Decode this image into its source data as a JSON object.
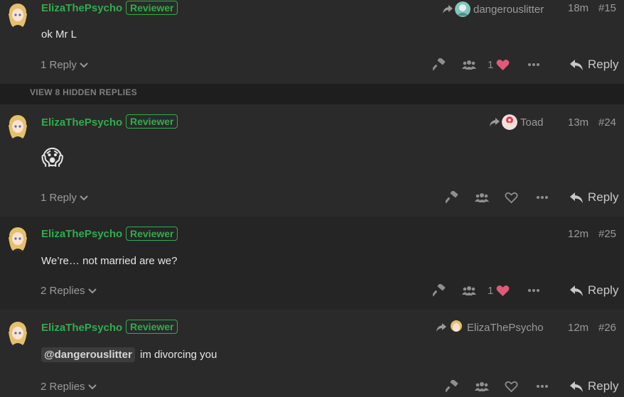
{
  "posts": [
    {
      "username": "ElizaThePsycho",
      "badge": "Reviewer",
      "reply_to": "dangerouslitter",
      "time": "18m",
      "number": "#15",
      "content": "ok Mr L",
      "replies": "1 Reply",
      "likes": "1",
      "liked": true,
      "reply_label": "Reply"
    },
    {
      "username": "ElizaThePsycho",
      "badge": "Reviewer",
      "reply_to": "Toad",
      "time": "13m",
      "number": "#24",
      "content_emoji": "😱",
      "replies": "1 Reply",
      "likes": "",
      "liked": false,
      "reply_label": "Reply"
    },
    {
      "username": "ElizaThePsycho",
      "badge": "Reviewer",
      "time": "12m",
      "number": "#25",
      "content": "We’re… not married are we?",
      "replies": "2 Replies",
      "likes": "1",
      "liked": true,
      "reply_label": "Reply"
    },
    {
      "username": "ElizaThePsycho",
      "badge": "Reviewer",
      "reply_to": "ElizaThePsycho",
      "time": "12m",
      "number": "#26",
      "mention": "@dangerouslitter",
      "content": "im divorcing you",
      "replies": "2 Replies",
      "likes": "",
      "liked": false,
      "reply_label": "Reply"
    }
  ],
  "hidden_replies": "VIEW 8 HIDDEN REPLIES",
  "colors": {
    "username": "#2eae4b",
    "heart": "#e05a7a",
    "background": "#2a2a2a"
  },
  "icons": [
    "share-arrow-icon",
    "chevron-down-icon",
    "hammer-icon",
    "group-icon",
    "heart-icon",
    "ellipsis-icon",
    "reply-arrow-icon"
  ]
}
